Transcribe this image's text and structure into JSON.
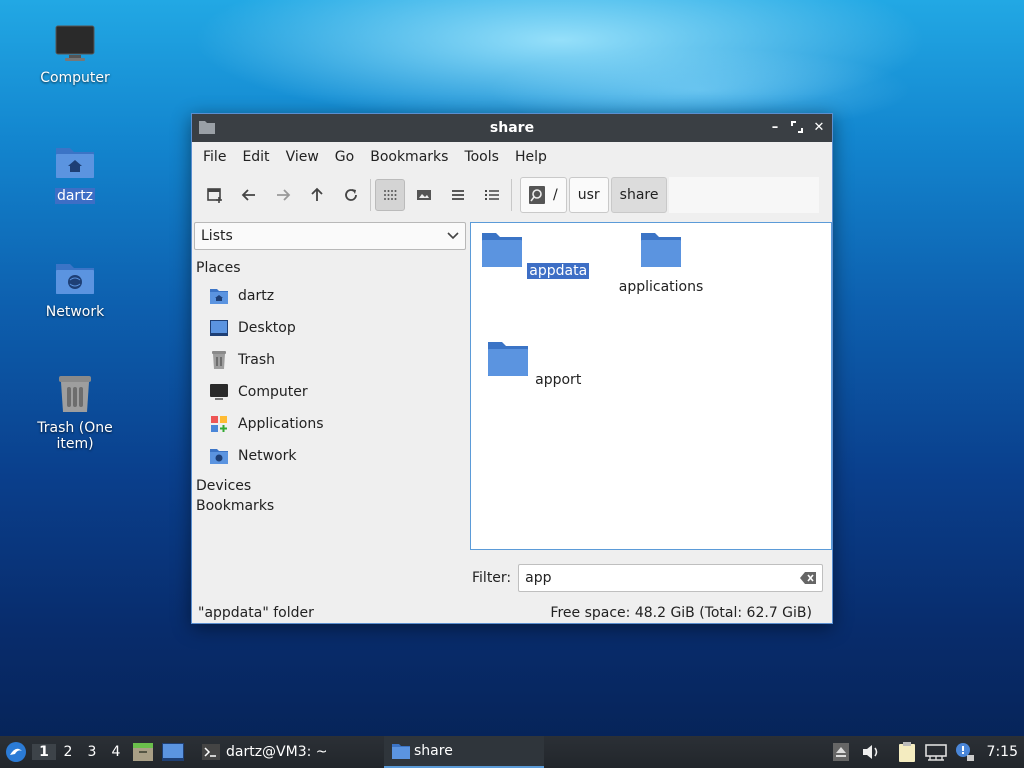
{
  "desktop": {
    "icons": [
      {
        "label": "Computer"
      },
      {
        "label": "dartz"
      },
      {
        "label": "Network"
      },
      {
        "label": "Trash (One item)"
      }
    ]
  },
  "window": {
    "title": "share",
    "menu": [
      "File",
      "Edit",
      "View",
      "Go",
      "Bookmarks",
      "Tools",
      "Help"
    ],
    "path": [
      "/",
      "usr",
      "share"
    ],
    "side_combo": "Lists",
    "sections": {
      "places": "Places",
      "devices": "Devices",
      "bookmarks": "Bookmarks"
    },
    "places": [
      "dartz",
      "Desktop",
      "Trash",
      "Computer",
      "Applications",
      "Network"
    ],
    "files": [
      {
        "name": "appdata",
        "selected": true
      },
      {
        "name": "applications",
        "selected": false
      },
      {
        "name": "apport",
        "selected": false
      }
    ],
    "filter_label": "Filter:",
    "filter_value": "app",
    "status_left": "\"appdata\" folder",
    "status_right": "Free space: 48.2 GiB (Total: 62.7 GiB)"
  },
  "taskbar": {
    "workspaces": [
      "1",
      "2",
      "3",
      "4"
    ],
    "tasks": [
      "dartz@VM3: ~",
      "share"
    ],
    "clock": "7:15"
  },
  "colors": {
    "accent": "#3d6ec5",
    "folder": "#4a86d8",
    "titlebar": "#3a3f44"
  }
}
